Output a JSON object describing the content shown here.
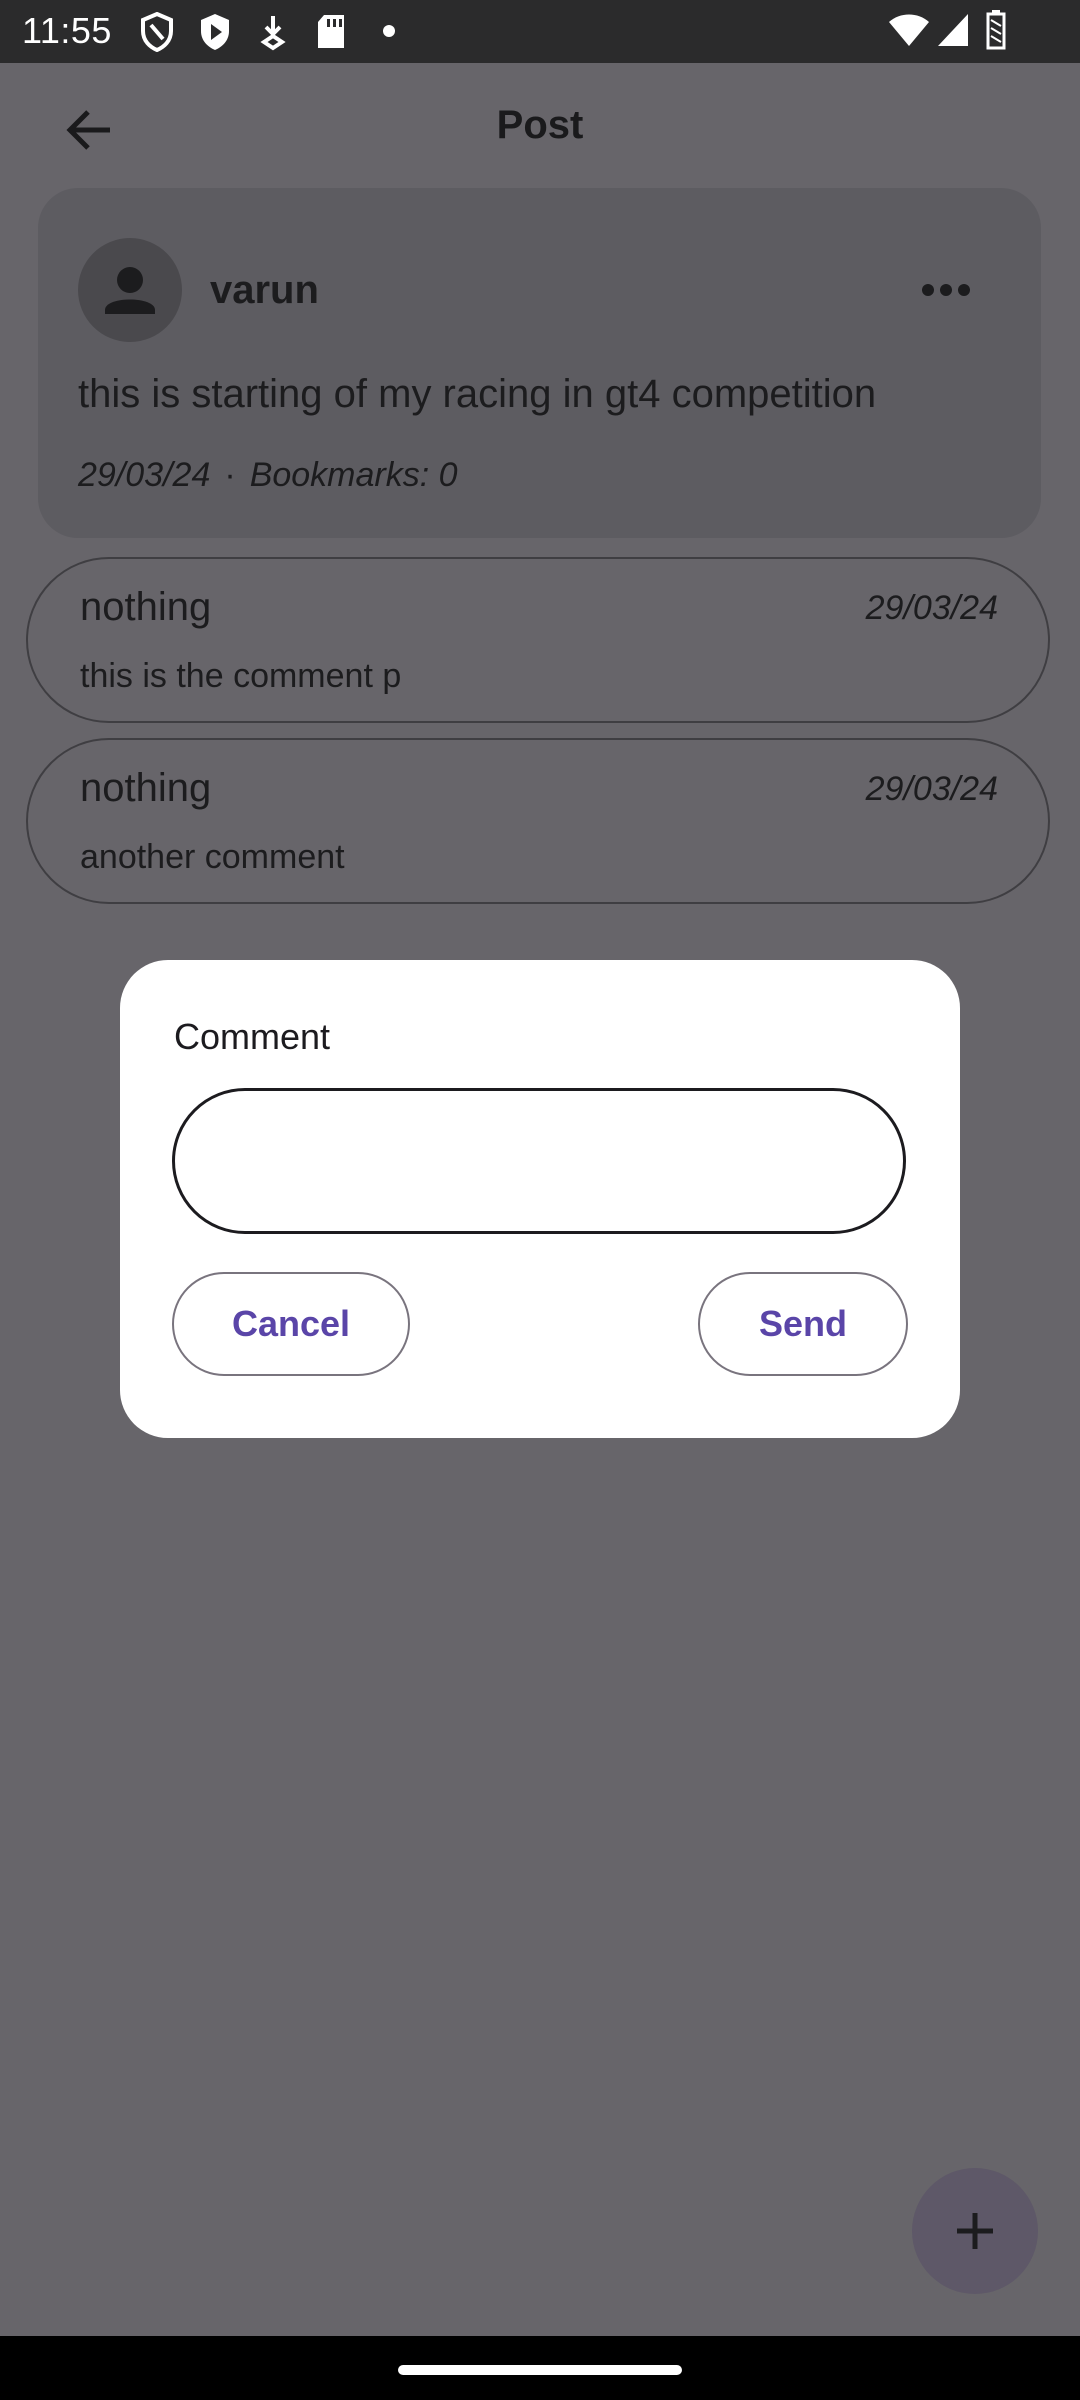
{
  "status_bar": {
    "time": "11:55",
    "icons": [
      "shield-icon",
      "play-shield-icon",
      "download-icon",
      "sd-card-icon",
      "dot-icon",
      "wifi-icon",
      "signal-icon",
      "battery-icon"
    ]
  },
  "app_bar": {
    "title": "Post",
    "back_icon": "arrow-back-icon"
  },
  "post": {
    "author": "varun",
    "text": "this is starting of my racing in gt4 competition",
    "date": "29/03/24",
    "separator": "·",
    "bookmarks": "Bookmarks: 0",
    "more_icon": "more-horiz-icon",
    "avatar_icon": "person-icon"
  },
  "comments": [
    {
      "author": "nothing",
      "date": "29/03/24",
      "text": "this is the comment p"
    },
    {
      "author": "nothing",
      "date": "29/03/24",
      "text": "another comment"
    }
  ],
  "dialog": {
    "label": "Comment",
    "input_value": "",
    "cancel_label": "Cancel",
    "send_label": "Send"
  },
  "fab": {
    "icon": "plus-icon"
  },
  "colors": {
    "scrim_background": "#67656a",
    "accent": "#5a45a8",
    "dialog_background": "#ffffff"
  }
}
